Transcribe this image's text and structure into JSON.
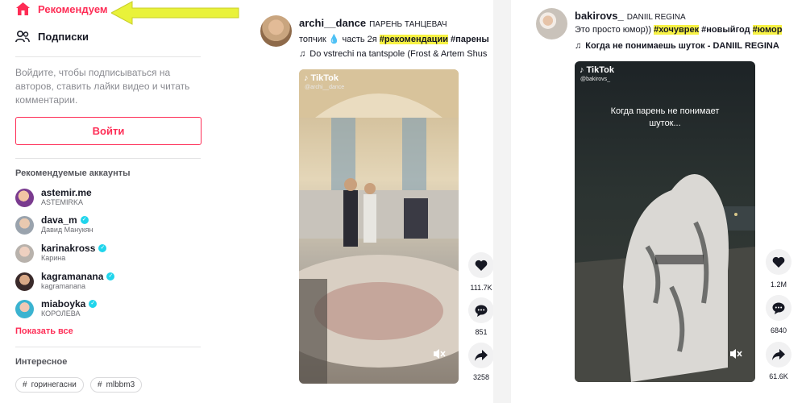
{
  "sidebar": {
    "nav": [
      {
        "label": "Рекомендуем",
        "icon": "home-icon"
      },
      {
        "label": "Подписки",
        "icon": "following-icon"
      }
    ],
    "login_hint": "Войдите, чтобы подписываться на авторов, ставить лайки видео и читать комментарии.",
    "login_button": "Войти",
    "suggested_title": "Рекомендуемые аккаунты",
    "accounts": [
      {
        "user": "astemir.me",
        "name": "ASTEMIRKA",
        "verified": false
      },
      {
        "user": "dava_m",
        "name": "Давид Манукян",
        "verified": true
      },
      {
        "user": "karinakross",
        "name": "Карина",
        "verified": true
      },
      {
        "user": "kagramanana",
        "name": "kagramanana",
        "verified": true
      },
      {
        "user": "miaboyka",
        "name": "КОРОЛЕВА",
        "verified": true
      }
    ],
    "show_all": "Показать все",
    "discover_title": "Интересное",
    "tags": [
      "горинегасни",
      "mlbbm3"
    ]
  },
  "posts": [
    {
      "username": "archi__dance",
      "nickname": "ПАРЕНЬ ТАНЦЕВАЧ",
      "caption_plain": "топчик 💧 часть 2я ",
      "caption_tags": [
        "#рекомендации",
        "#парены"
      ],
      "music": "Do vstrechi na tantspole (Frost & Artem Shus",
      "video_brand": "TikTok",
      "video_handle": "@archi__dance",
      "likes": "111.7K",
      "comments": "851",
      "shares": "3258"
    },
    {
      "username": "bakirovs_",
      "nickname": "DANIIL REGINA",
      "caption_plain": "Это просто юмор)) ",
      "caption_tags": [
        "#хочуврек",
        "#новыйгод",
        "#юмор"
      ],
      "music": "Когда не понимаешь шуток - DANIIL REGINA",
      "video_brand": "TikTok",
      "video_handle": "@bakirovs_",
      "video_overlay": "Когда парень не понимает шуток...",
      "likes": "1.2M",
      "comments": "6840",
      "shares": "61.6K"
    }
  ],
  "colors": {
    "accent": "#fe2c55",
    "highlight": "#f7f244",
    "verified": "#20d5ec",
    "arrow": "#e9f23a"
  }
}
